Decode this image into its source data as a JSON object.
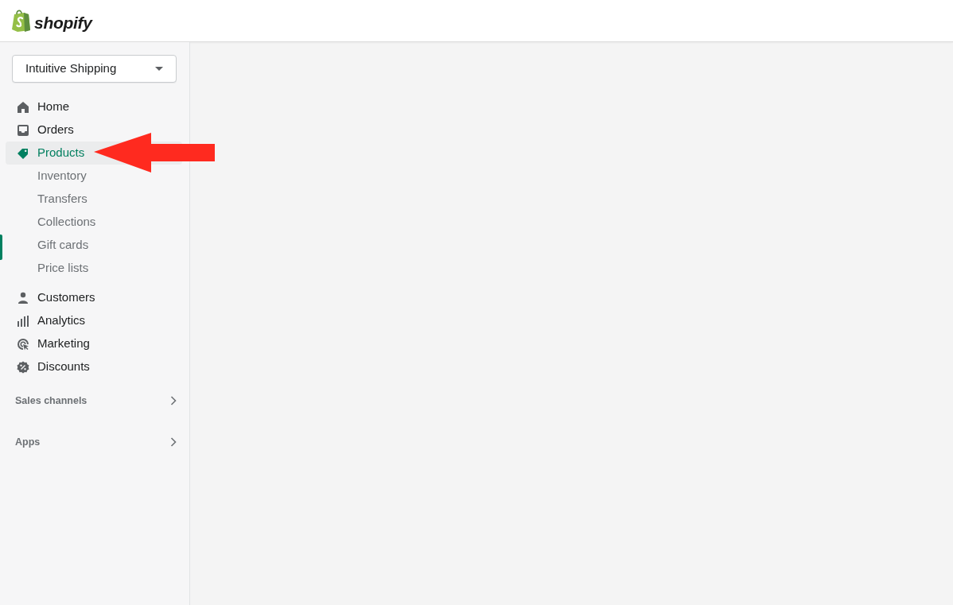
{
  "header": {
    "logo_text": "shopify"
  },
  "store_selector": {
    "label": "Intuitive Shipping"
  },
  "nav": [
    {
      "label": "Home",
      "selected": false
    },
    {
      "label": "Orders",
      "selected": false
    },
    {
      "label": "Products",
      "selected": true,
      "children": [
        {
          "label": "Inventory",
          "selected": false
        },
        {
          "label": "Transfers",
          "selected": false
        },
        {
          "label": "Collections",
          "selected": false
        },
        {
          "label": "Gift cards",
          "selected": false
        },
        {
          "label": "Price lists",
          "selected": false
        }
      ]
    },
    {
      "label": "Customers",
      "selected": false
    },
    {
      "label": "Analytics",
      "selected": false
    },
    {
      "label": "Marketing",
      "selected": false
    },
    {
      "label": "Discounts",
      "selected": false
    }
  ],
  "sections": [
    {
      "label": "Sales channels"
    },
    {
      "label": "Apps"
    }
  ]
}
